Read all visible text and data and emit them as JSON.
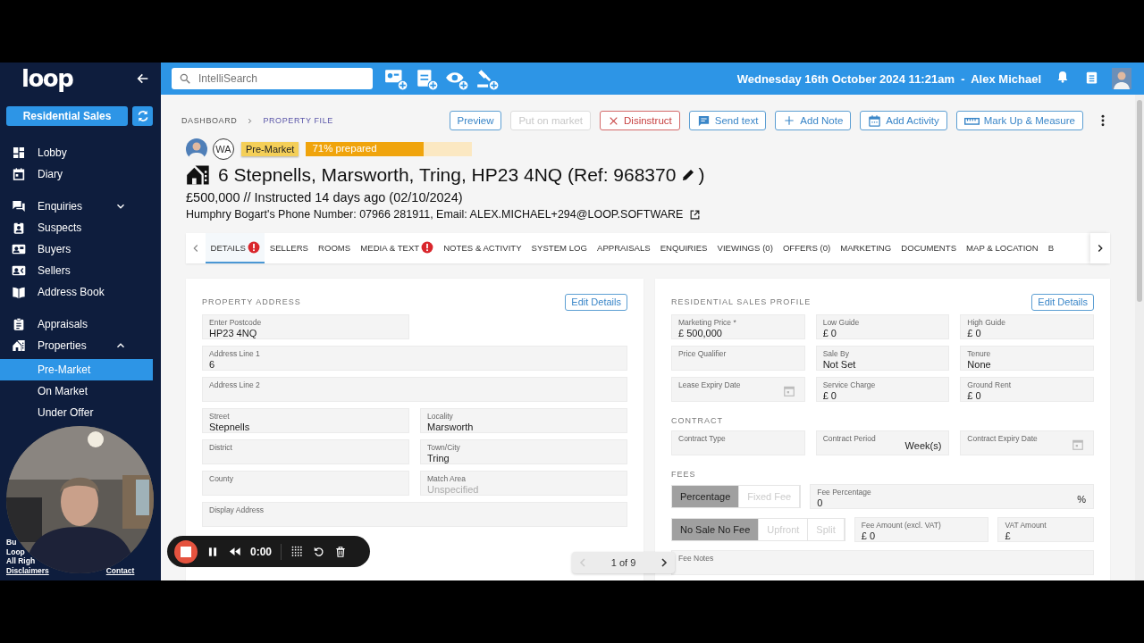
{
  "sidebar": {
    "logo": "loop",
    "department": "Residential Sales",
    "sections": [
      [
        {
          "label": "Lobby",
          "kind": "link",
          "selected": false
        },
        {
          "label": "Diary",
          "kind": "link",
          "selected": false
        }
      ],
      [
        {
          "label": "Enquiries",
          "kind": "group",
          "expanded": false,
          "selected": false
        },
        {
          "label": "Suspects",
          "kind": "link",
          "selected": false
        },
        {
          "label": "Buyers",
          "kind": "link",
          "selected": false
        },
        {
          "label": "Sellers",
          "kind": "link",
          "selected": false
        },
        {
          "label": "Address Book",
          "kind": "link",
          "selected": false
        }
      ],
      [
        {
          "label": "Appraisals",
          "kind": "link",
          "selected": false
        },
        {
          "label": "Properties",
          "kind": "group",
          "expanded": true,
          "selected": false,
          "children": [
            {
              "label": "Pre-Market",
              "selected": true
            },
            {
              "label": "On Market",
              "selected": false
            },
            {
              "label": "Under Offer",
              "selected": false
            }
          ]
        }
      ]
    ],
    "footer": [
      "Bu",
      "Loop",
      "All Righ"
    ],
    "footer_links": [
      "Disclaimers",
      "Contact"
    ]
  },
  "top_bar": {
    "search": {
      "placeholder": "IntelliSearch"
    },
    "status": "Wednesday 16th October 2024 11:21am  -  Alex Michael"
  },
  "breadcrumbs": [
    {
      "label": "DASHBOARD",
      "selected": false
    },
    {
      "label": "PROPERTY FILE",
      "selected": true
    }
  ],
  "actions": [
    {
      "label": "Preview",
      "kind": "default",
      "disabled": false
    },
    {
      "label": "Put on market",
      "kind": "default",
      "disabled": true
    },
    {
      "label": "Disinstruct",
      "kind": "danger",
      "disabled": false
    },
    {
      "label": "Send text",
      "kind": "default",
      "disabled": false
    },
    {
      "label": "Add Note",
      "kind": "default",
      "disabled": false
    },
    {
      "label": "Add Activity",
      "kind": "default",
      "disabled": false
    },
    {
      "label": "Mark Up & Measure",
      "kind": "default",
      "disabled": false
    }
  ],
  "property": {
    "initials": "WA",
    "status": "Pre-Market",
    "progress": {
      "label": "71% prepared",
      "level": 0.71
    },
    "title": "6 Stepnells, Marsworth, Tring, HP23 4NQ (Ref: 968370",
    "title_end": ")",
    "summary": "£500,000 // Instructed 14 days ago (02/10/2024)",
    "contact": "Humphry Bogart's Phone Number: 07966 281911, Email: ALEX.MICHAEL+294@LOOP.SOFTWARE"
  },
  "tabs": [
    {
      "label": "DETAILS",
      "selected": true,
      "alert": true
    },
    {
      "label": "SELLERS",
      "selected": false,
      "alert": false
    },
    {
      "label": "ROOMS",
      "selected": false,
      "alert": false
    },
    {
      "label": "MEDIA & TEXT",
      "selected": false,
      "alert": true
    },
    {
      "label": "NOTES & ACTIVITY",
      "selected": false,
      "alert": false
    },
    {
      "label": "SYSTEM LOG",
      "selected": false,
      "alert": false
    },
    {
      "label": "APPRAISALS",
      "selected": false,
      "alert": false
    },
    {
      "label": "ENQUIRIES",
      "selected": false,
      "alert": false
    },
    {
      "label": "VIEWINGS (0)",
      "selected": false,
      "alert": false
    },
    {
      "label": "OFFERS (0)",
      "selected": false,
      "alert": false
    },
    {
      "label": "MARKETING",
      "selected": false,
      "alert": false
    },
    {
      "label": "DOCUMENTS",
      "selected": false,
      "alert": false
    },
    {
      "label": "MAP & LOCATION",
      "selected": false,
      "alert": false
    },
    {
      "label": "B",
      "selected": false,
      "alert": false
    }
  ],
  "address_panel": {
    "heading": "PROPERTY ADDRESS",
    "button": "Edit Details",
    "fields": [
      {
        "label": "Enter Postcode",
        "value": "HP23 4NQ",
        "kind": "half"
      },
      {
        "label": "Address Line 1",
        "value": "6",
        "kind": "full"
      },
      {
        "label": "Address Line 2",
        "kind": "full"
      },
      {
        "label": "Street",
        "value": "Stepnells",
        "kind": "half"
      },
      {
        "label": "Locality",
        "value": "Marsworth",
        "kind": "half"
      },
      {
        "label": "District",
        "kind": "half"
      },
      {
        "label": "Town/City",
        "value": "Tring",
        "kind": "half"
      },
      {
        "label": "County",
        "kind": "half"
      },
      {
        "label": "Match Area",
        "placeholder": "Unspecified",
        "kind": "half"
      },
      {
        "label": "Display Address",
        "kind": "full"
      }
    ]
  },
  "profile_panel": {
    "heading": "RESIDENTIAL SALES PROFILE",
    "button": "Edit Details",
    "fields": [
      {
        "label": "Marketing Price *",
        "value": "£ 500,000",
        "kind": "text"
      },
      {
        "label": "Low Guide",
        "value": "£ 0",
        "kind": "text"
      },
      {
        "label": "High Guide",
        "value": "£ 0",
        "kind": "text"
      },
      {
        "label": "Price Qualifier",
        "kind": "text"
      },
      {
        "label": "Sale By",
        "value": "Not Set",
        "kind": "text"
      },
      {
        "label": "Tenure",
        "value": "None",
        "kind": "text"
      },
      {
        "label": "Lease Expiry Date",
        "kind": "date"
      },
      {
        "label": "Service Charge",
        "value": "£ 0",
        "kind": "text"
      },
      {
        "label": "Ground Rent",
        "value": "£ 0",
        "kind": "text"
      }
    ],
    "contract": {
      "heading": "CONTRACT",
      "fields": [
        {
          "label": "Contract Type",
          "kind": "text"
        },
        {
          "label": "Contract Period",
          "suffix": "Week(s)",
          "kind": "text"
        },
        {
          "label": "Contract Expiry Date",
          "kind": "date"
        }
      ]
    },
    "fees": {
      "heading": "FEES",
      "basis": [
        {
          "label": "Percentage",
          "selected": true
        },
        {
          "label": "Fixed Fee",
          "selected": false
        }
      ],
      "fee_percentage": {
        "label": "Fee Percentage",
        "value": "0",
        "suffix": "%"
      },
      "timing": [
        {
          "label": "No Sale No Fee",
          "selected": true
        },
        {
          "label": "Upfront",
          "selected": false
        },
        {
          "label": "Split",
          "selected": false
        }
      ],
      "fee_amount": {
        "label": "Fee Amount (excl. VAT)",
        "value": "£ 0"
      },
      "vat_amount": {
        "label": "VAT Amount",
        "value": "£"
      },
      "fee_notes": {
        "label": "Fee Notes"
      }
    }
  },
  "pager": {
    "label": "1 of 9",
    "prev": {
      "disabled": true
    },
    "next": {
      "disabled": false
    }
  },
  "recorder": {
    "time": "0:00"
  }
}
